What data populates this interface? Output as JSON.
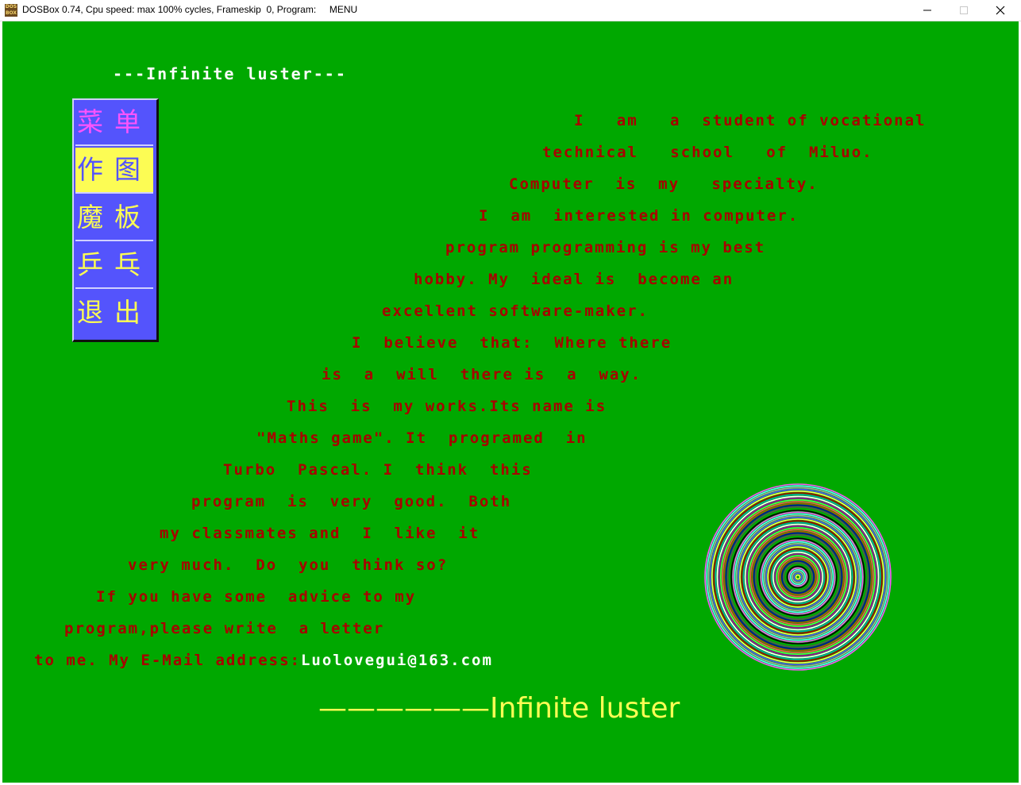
{
  "window": {
    "title": "DOSBox 0.74, Cpu speed: max 100% cycles, Frameskip  0, Program:     MENU",
    "icon": "dosbox-icon",
    "controls": [
      "minimize",
      "maximize",
      "close"
    ]
  },
  "screen": {
    "header": "---Infinite luster---",
    "menu": [
      {
        "label": "菜单",
        "color": "#fc54fc",
        "selected": false
      },
      {
        "label": "作图",
        "color": "#5454fc",
        "selected": true
      },
      {
        "label": "魔板",
        "color": "#fcfc54",
        "selected": false
      },
      {
        "label": "乒乓",
        "color": "#fcfc54",
        "selected": false
      },
      {
        "label": "退出",
        "color": "#fcfc54",
        "selected": false
      }
    ],
    "story": [
      "I   am   a  student of vocational",
      "technical   school   of  Miluo.",
      "Computer  is  my   specialty.",
      "I  am  interested in computer.",
      "program programming is my best",
      "hobby. My  ideal is  become an",
      "excellent software-maker.",
      "I  believe  that:  Where there",
      "is  a  will  there is  a  way.",
      "This  is  my works.Its name is",
      "\"Maths game\". It  programed  in",
      "Turbo  Pascal. I  think  this",
      "program  is  very  good.  Both",
      "my classmates and  I  like  it",
      "very much.  Do  you  think so?",
      "If you have some  advice to my",
      "program,please write  a letter",
      "to me. My E-Mail address:"
    ],
    "email": "Luolovegui@163.com",
    "footer": "——————Infinite luster",
    "colors": {
      "background": "#00a800",
      "story_text": "#a80000",
      "header_text": "#ffffff",
      "footer_text": "#fcfc54",
      "menu_bg": "#5454fc",
      "menu_selected_bg": "#fcfc54"
    }
  }
}
